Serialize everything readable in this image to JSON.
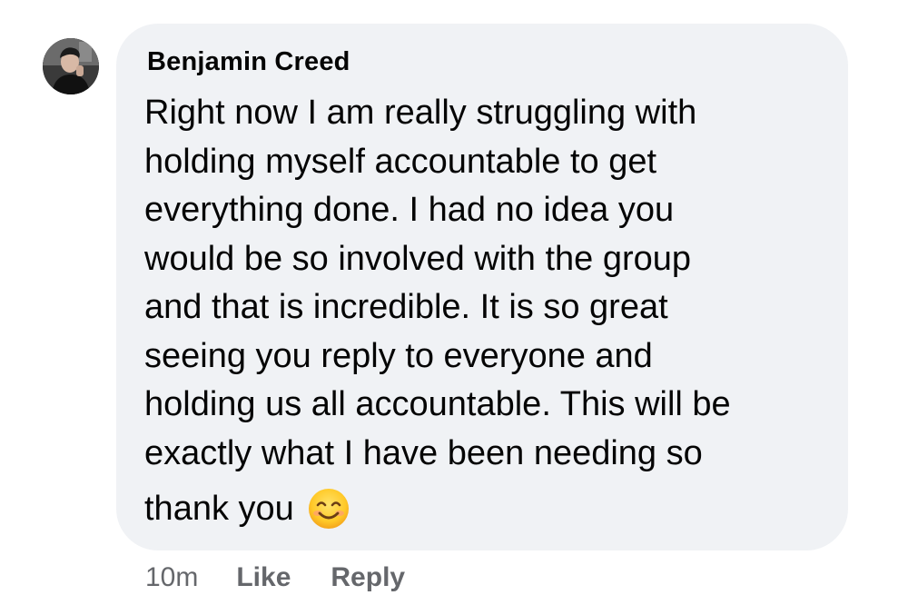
{
  "comment": {
    "author": "Benjamin Creed",
    "lines": [
      "Right now I am really struggling with",
      "holding myself accountable to get",
      "everything done. I had no idea you",
      "would be so involved with the group",
      "and that is incredible. It is so great",
      "seeing you reply to everyone and",
      "holding us all accountable. This will be",
      "exactly what I have been needing so"
    ],
    "last_line": "thank you",
    "emoji": "smiling-face-with-smiling-eyes"
  },
  "actions": {
    "timestamp": "10m",
    "like_label": "Like",
    "reply_label": "Reply"
  },
  "colors": {
    "bubble": "#f0f2f5",
    "text": "#050505",
    "meta": "#65676b"
  }
}
